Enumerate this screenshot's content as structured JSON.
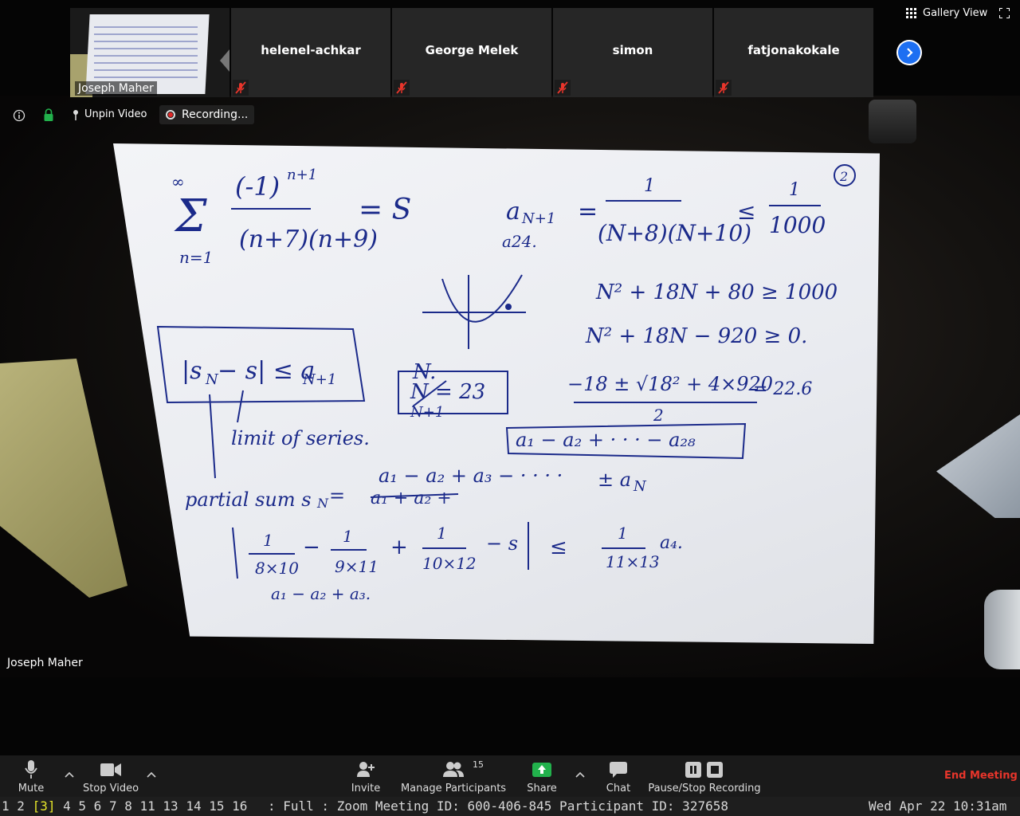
{
  "participants": {
    "self": {
      "name": "Joseph Maher"
    },
    "tiles": [
      {
        "name": "helenel-achkar",
        "muted": true
      },
      {
        "name": "George Melek",
        "muted": true
      },
      {
        "name": "simon",
        "muted": true
      },
      {
        "name": "fatjonakokale",
        "muted": true
      }
    ]
  },
  "top_right": {
    "view_label": "Gallery View"
  },
  "video_bar": {
    "unpin_label": "Unpin Video",
    "recording_label": "Recording..."
  },
  "active_speaker": {
    "name": "Joseph Maher"
  },
  "toolbar": {
    "mute": "Mute",
    "stop_video": "Stop Video",
    "invite": "Invite",
    "manage_participants": "Manage Participants",
    "participant_count": "15",
    "share": "Share",
    "chat": "Chat",
    "pause_stop_recording": "Pause/Stop Recording",
    "end_meeting": "End Meeting"
  },
  "statusbar": {
    "workspaces": [
      "1",
      "2",
      "3",
      "4",
      "5",
      "6",
      "7",
      "8",
      "11",
      "13",
      "14",
      "15",
      "16"
    ],
    "active_workspace": "3",
    "layout": ": Full :",
    "window_title": "Zoom Meeting ID: 600-406-845 Participant ID: 327658",
    "clock": "Wed Apr 22 10:31am"
  },
  "colors": {
    "accent_blue": "#1d6ff2",
    "share_green": "#22b14c",
    "end_red": "#e8352b",
    "active_ws": "#e6e62a"
  }
}
